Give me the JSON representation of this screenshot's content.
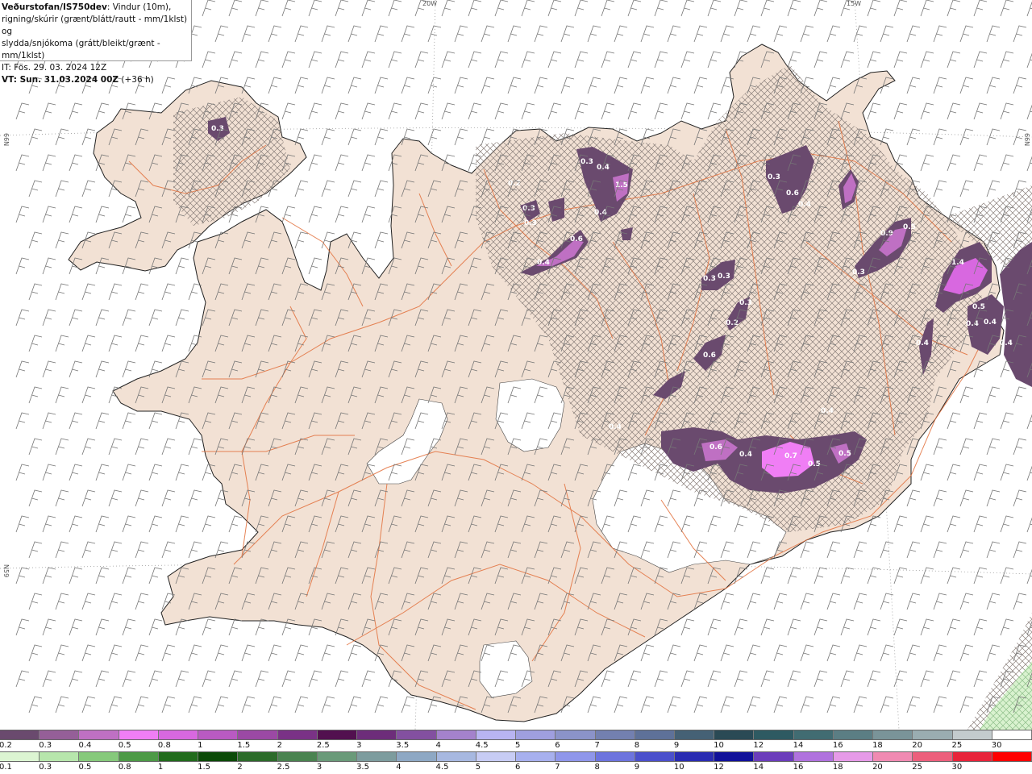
{
  "title": {
    "model": "Veðurstofan/IS750dev",
    "description_line1": ": Vindur (10m),",
    "description_line2": "rigning/skúrir (grænt/blátt/rautt - mm/1klst) og",
    "description_line3": "slydda/snjókoma (grátt/bleikt/grænt - mm/1klst)",
    "issue_time": "IT: Fös. 29. 03. 2024 12Z",
    "valid_time": "VT: Sun. 31.03.2024 00Z",
    "lead_time": "(+36 h)"
  },
  "graticule": {
    "lon_labels": [
      "20W",
      "15W"
    ],
    "lat_labels": [
      "66N",
      "N59"
    ]
  },
  "precip_labels": [
    "0.3",
    "0.3",
    "0.4",
    "1.5",
    "0.4",
    "0.3",
    "0.3",
    "0.2",
    "0.6",
    "0.3",
    "0.6",
    "0.4",
    "0.4",
    "0.3",
    "0.9",
    "0.5",
    "0.3",
    "0.3",
    "0.3",
    "0.2",
    "0.6",
    "1.4",
    "0.5",
    "0.4",
    "0.4",
    "0.4",
    "0.4",
    "0.4",
    "0.4",
    "0.6",
    "0.4",
    "0.7",
    "0.5",
    "0.5"
  ],
  "legend_snow": {
    "labels": [
      "0.2",
      "0.3",
      "0.4",
      "0.5",
      "0.8",
      "1",
      "1.5",
      "2",
      "2.5",
      "3",
      "3.5",
      "4",
      "4.5",
      "5",
      "6",
      "7",
      "8",
      "9",
      "10",
      "12",
      "14",
      "16",
      "18",
      "20",
      "25",
      "30"
    ],
    "colors": [
      "#6a4a6e",
      "#955f98",
      "#bf70c3",
      "#f07ef5",
      "#d868e0",
      "#b95ac2",
      "#9b49a4",
      "#7a3286",
      "#52104f",
      "#6d2d7a",
      "#8350a0",
      "#a482cc",
      "#b8b4f2",
      "#9f9fdf",
      "#8b93c9",
      "#7380b0",
      "#5e7199",
      "#456175",
      "#2a4a55",
      "#2e5a62",
      "#416c72",
      "#5b7e84",
      "#7a9499",
      "#9aadb1",
      "#c3cbcd",
      "#ffffff"
    ]
  },
  "legend_rain": {
    "labels": [
      "0.1",
      "0.3",
      "0.5",
      "0.8",
      "1",
      "1.5",
      "2",
      "2.5",
      "3",
      "3.5",
      "4",
      "4.5",
      "5",
      "6",
      "7",
      "8",
      "9",
      "10",
      "12",
      "14",
      "16",
      "18",
      "20",
      "25",
      "30"
    ],
    "colors": [
      "#dcf5d2",
      "#b7e6ac",
      "#86c97b",
      "#4d9a46",
      "#216b1c",
      "#0b4a08",
      "#2c6b2a",
      "#4a8350",
      "#6a9a79",
      "#7d9c9e",
      "#8ea8c4",
      "#a7b8e0",
      "#c7ccf4",
      "#a7b0ee",
      "#8f96ea",
      "#6d74de",
      "#4b50cc",
      "#2a2cb2",
      "#11119a",
      "#6b3dbb",
      "#b072de",
      "#e69ae8",
      "#f08ab2",
      "#ec5f7c",
      "#e8243a",
      "#ff0000"
    ]
  }
}
